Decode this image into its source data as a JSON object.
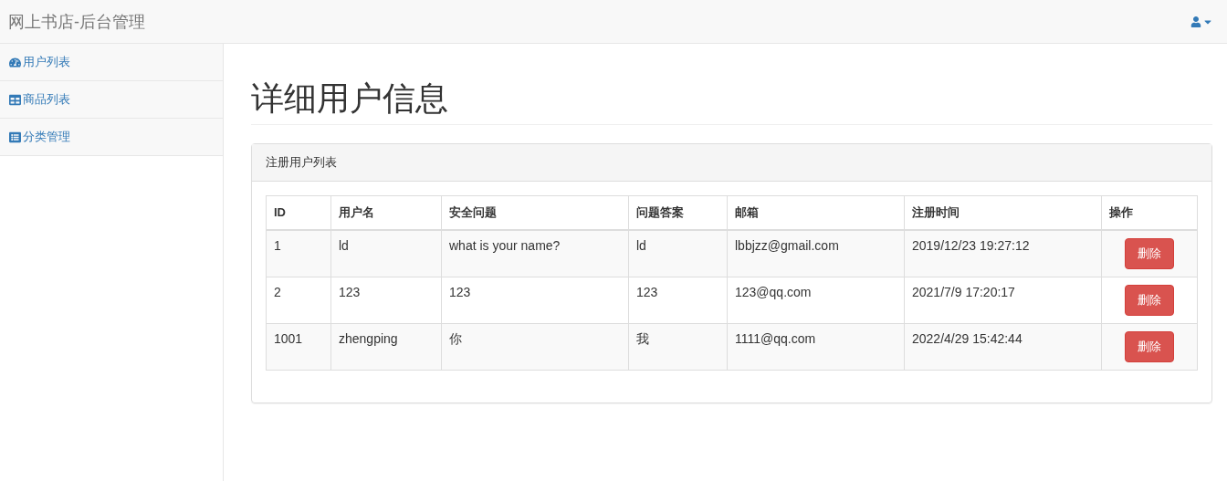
{
  "navbar": {
    "brand": "网上书店-后台管理"
  },
  "sidebar": {
    "items": [
      {
        "label": "用户列表",
        "kind": "gauge"
      },
      {
        "label": "商品列表",
        "kind": "table"
      },
      {
        "label": "分类管理",
        "kind": "list"
      }
    ]
  },
  "page": {
    "title": "详细用户信息"
  },
  "panel": {
    "heading": "注册用户列表",
    "table": {
      "columns": [
        "ID",
        "用户名",
        "安全问题",
        "问题答案",
        "邮箱",
        "注册时间",
        "操作"
      ],
      "rows": [
        {
          "cells": [
            "1",
            "ld",
            "what is your name?",
            "ld",
            "lbbjzz@gmail.com",
            "2019/12/23 19:27:12"
          ],
          "action": "删除"
        },
        {
          "cells": [
            "2",
            "123",
            "123",
            "123",
            "123@qq.com",
            "2021/7/9 17:20:17"
          ],
          "action": "删除"
        },
        {
          "cells": [
            "1001",
            "zhengping",
            "你",
            "我",
            "1111@qq.com",
            "2022/4/29 15:42:44"
          ],
          "action": "删除"
        }
      ]
    }
  }
}
